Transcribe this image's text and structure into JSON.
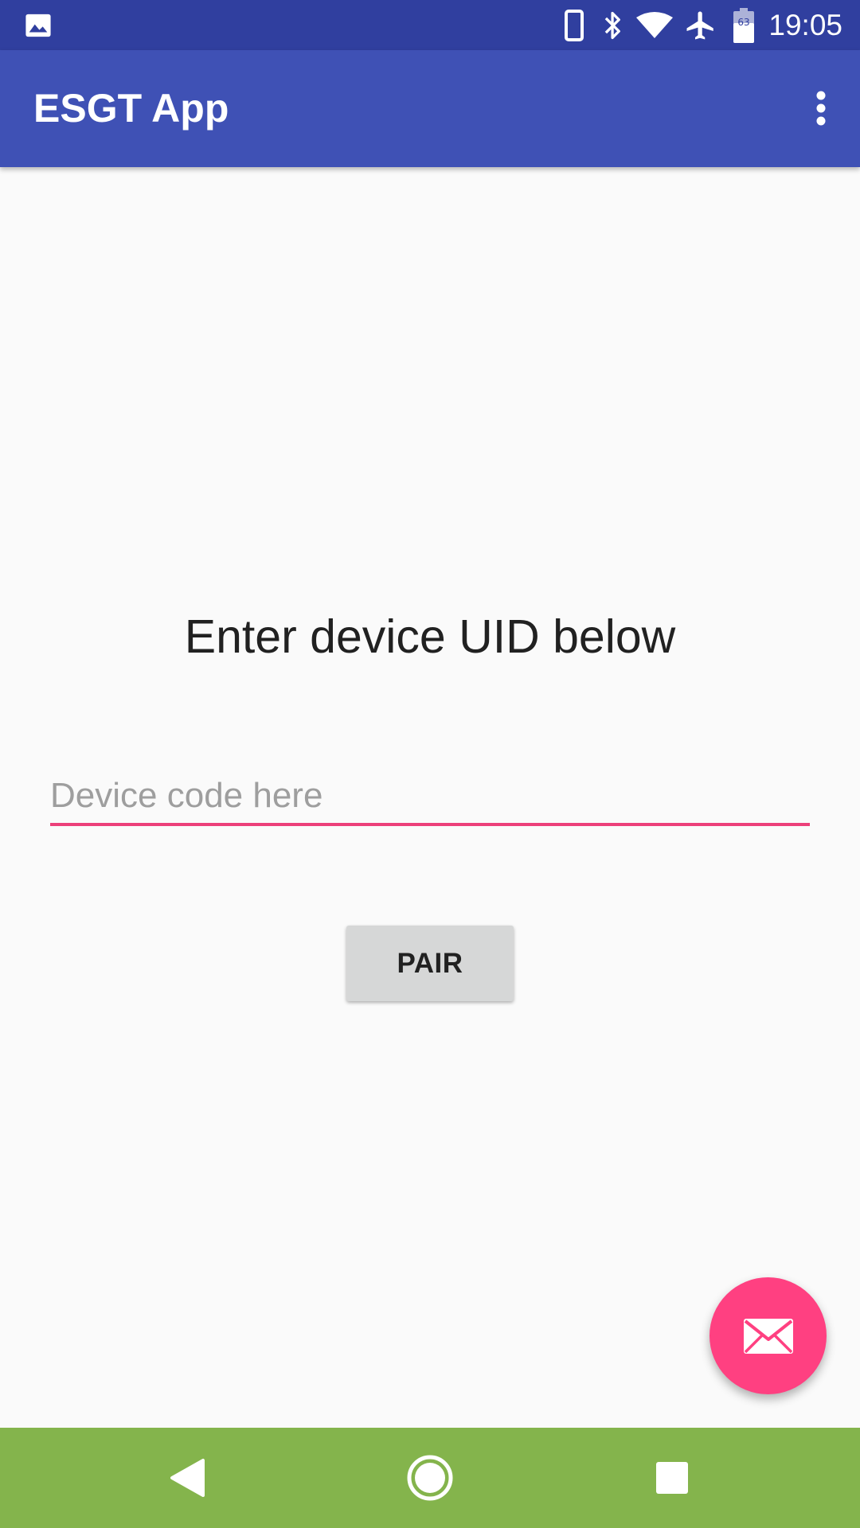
{
  "status_bar": {
    "time": "19:05",
    "battery_level": "63",
    "icons": [
      "image-icon",
      "phone-icon",
      "bluetooth-icon",
      "wifi-icon",
      "airplane-mode-icon",
      "battery-icon"
    ]
  },
  "app_bar": {
    "title": "ESGT App",
    "menu_icon": "overflow-menu-icon"
  },
  "main": {
    "heading": "Enter device UID below",
    "device_input": {
      "value": "",
      "placeholder": "Device code here"
    },
    "pair_button_label": "PAIR",
    "fab_icon": "mail-icon"
  },
  "nav_bar": {
    "buttons": [
      "back-icon",
      "home-icon",
      "recents-icon"
    ]
  },
  "colors": {
    "status_bar": "#303F9F",
    "app_bar": "#3F51B5",
    "accent": "#FF4081",
    "input_underline": "#EC407A",
    "nav_bar": "#84B44C",
    "background": "#FAFAFA",
    "button": "#D6D7D7"
  }
}
